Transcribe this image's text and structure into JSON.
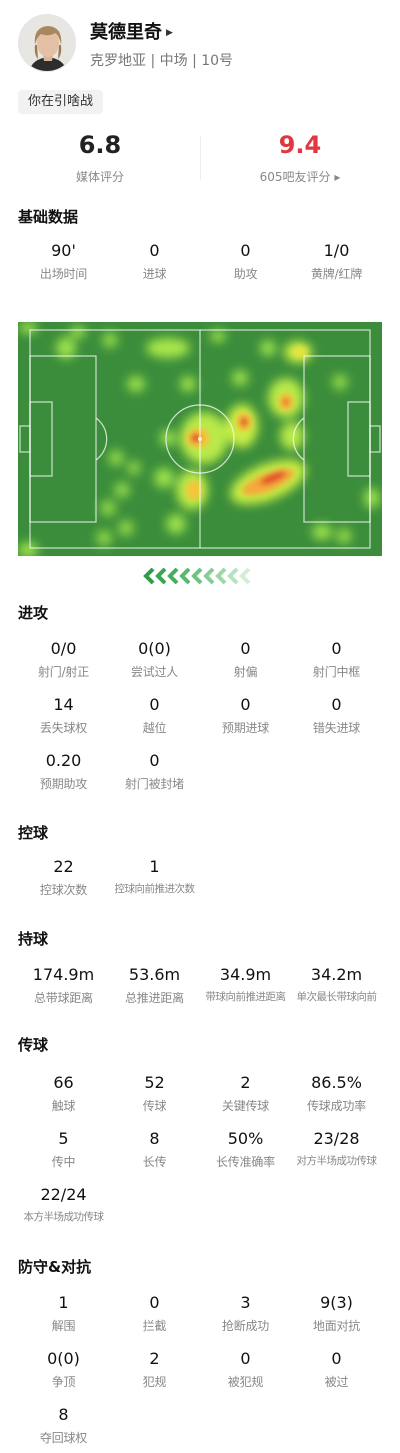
{
  "player": {
    "name": "莫德里奇",
    "meta": "克罗地亚 | 中场 | 10号",
    "tag": "你在引啥战",
    "media_rating": "6.8",
    "media_rating_label": "媒体评分",
    "fan_rating": "9.4",
    "fan_rating_label": "605吧友评分 ▸",
    "colors": {
      "fan_rating": "#e0383e",
      "heat_base": "#3b8d3b",
      "arrow": "#4caf50"
    }
  },
  "sections": {
    "basic": "基础数据",
    "attack": "进攻",
    "control": "控球",
    "carry": "持球",
    "pass": "传球",
    "defense": "防守&对抗"
  },
  "basic": [
    {
      "v": "90'",
      "l": "出场时间"
    },
    {
      "v": "0",
      "l": "进球"
    },
    {
      "v": "0",
      "l": "助攻"
    },
    {
      "v": "1/0",
      "l": "黄牌/红牌"
    }
  ],
  "attack": [
    {
      "v": "0/0",
      "l": "射门/射正"
    },
    {
      "v": "0(0)",
      "l": "尝试过人"
    },
    {
      "v": "0",
      "l": "射偏"
    },
    {
      "v": "0",
      "l": "射门中框"
    },
    {
      "v": "14",
      "l": "丢失球权"
    },
    {
      "v": "0",
      "l": "越位"
    },
    {
      "v": "0",
      "l": "预期进球"
    },
    {
      "v": "0",
      "l": "错失进球"
    },
    {
      "v": "0.20",
      "l": "预期助攻"
    },
    {
      "v": "0",
      "l": "射门被封堵"
    }
  ],
  "control": [
    {
      "v": "22",
      "l": "控球次数"
    },
    {
      "v": "1",
      "l": "控球向前推进次数"
    }
  ],
  "carry": [
    {
      "v": "174.9m",
      "l": "总带球距离"
    },
    {
      "v": "53.6m",
      "l": "总推进距离"
    },
    {
      "v": "34.9m",
      "l": "带球向前推进距离"
    },
    {
      "v": "34.2m",
      "l": "单次最长带球向前"
    }
  ],
  "pass": [
    {
      "v": "66",
      "l": "触球"
    },
    {
      "v": "52",
      "l": "传球"
    },
    {
      "v": "2",
      "l": "关键传球"
    },
    {
      "v": "86.5%",
      "l": "传球成功率"
    },
    {
      "v": "5",
      "l": "传中"
    },
    {
      "v": "8",
      "l": "长传"
    },
    {
      "v": "50%",
      "l": "长传准确率"
    },
    {
      "v": "23/28",
      "l": "对方半场成功传球"
    },
    {
      "v": "22/24",
      "l": "本方半场成功传球"
    }
  ],
  "defense": [
    {
      "v": "1",
      "l": "解围"
    },
    {
      "v": "0",
      "l": "拦截"
    },
    {
      "v": "3",
      "l": "抢断成功"
    },
    {
      "v": "9(3)",
      "l": "地面对抗"
    },
    {
      "v": "0(0)",
      "l": "争顶"
    },
    {
      "v": "2",
      "l": "犯规"
    },
    {
      "v": "0",
      "l": "被犯规"
    },
    {
      "v": "0",
      "l": "被过"
    },
    {
      "v": "8",
      "l": "夺回球权"
    }
  ]
}
